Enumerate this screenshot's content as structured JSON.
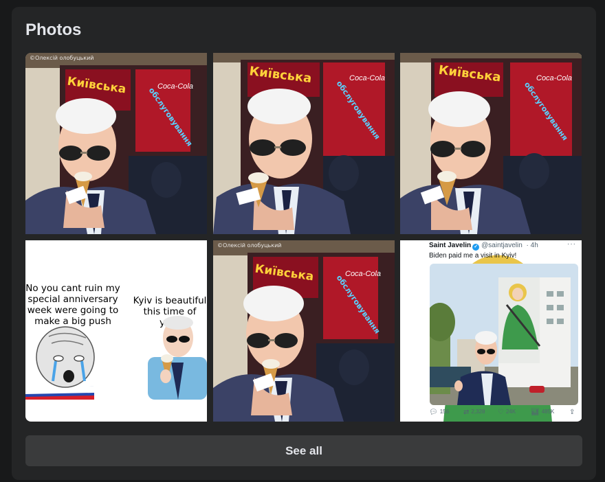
{
  "section": {
    "title": "Photos"
  },
  "photos": [
    {
      "credit": "©Олексій олобуцький",
      "sign_1": "Київська",
      "sign_2": "обслуговування",
      "brand": "Coca-Cola"
    },
    {
      "credit": "",
      "sign_1": "Київська",
      "sign_2": "обслуговування",
      "brand": "Coca-Cola"
    },
    {
      "credit": "",
      "sign_1": "Київська",
      "sign_2": "обслуговування",
      "brand": "Coca-Cola"
    },
    {
      "meme_left": "No you cant ruin my special anniversary week were going to make a big push",
      "meme_right": "Kyiv is beautiful this time of year"
    },
    {
      "credit": "©Олексій олобуцький",
      "sign_1": "Київська",
      "sign_2": "обслуговування",
      "brand": "Coca-Cola"
    },
    {
      "tweet": {
        "name": "Saint Javelin",
        "handle": "@saintjavelin",
        "time": "· 4h",
        "text": "Biden paid me a visit in Kyiv!",
        "replies": "156",
        "retweets": "2,328",
        "likes": "24K",
        "views": "485K"
      }
    }
  ],
  "see_all_label": "See all",
  "colors": {
    "page_bg": "#18191a",
    "card_bg": "#242526",
    "button_bg": "#3a3b3c",
    "text": "#e4e6eb"
  }
}
